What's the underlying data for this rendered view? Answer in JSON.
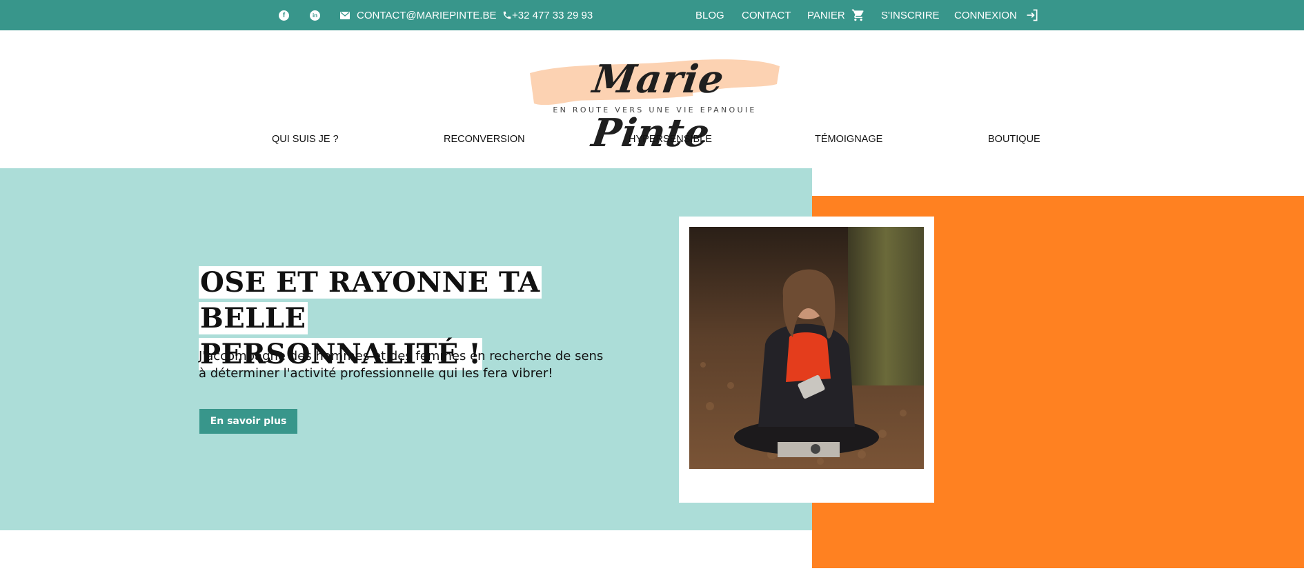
{
  "topbar": {
    "email": "CONTACT@MARIEPINTE.BE",
    "phone": "+32 477 33 29 93",
    "blog": "BLOG",
    "contact": "CONTACT",
    "cart": "PANIER",
    "register": "S'INSCRIRE",
    "login": "CONNEXION",
    "icons": [
      "facebook-icon",
      "linkedin-icon",
      "mail-icon",
      "phone-icon",
      "cart-icon",
      "login-icon"
    ]
  },
  "logo": {
    "name": "Marie Pinte",
    "tagline": "EN ROUTE VERS UNE VIE EPANOUIE"
  },
  "nav": {
    "items": [
      {
        "label": "QUI SUIS JE ?"
      },
      {
        "label": "RECONVERSION"
      },
      {
        "label": "HYPERSENSIBLE"
      },
      {
        "label": "TÉMOIGNAGE"
      },
      {
        "label": "BOUTIQUE"
      }
    ]
  },
  "hero": {
    "title_line1": "OSE ET RAYONNE TA BELLE",
    "title_line2": "PERSONNALITÉ !",
    "subtitle": "J'accompagne des hommes et des femmes en recherche de sens à déterminer l'activité professionnelle qui les fera vibrer!",
    "cta_label": "En savoir plus"
  },
  "colors": {
    "brand_teal": "#38968b",
    "hero_bg": "#acddd8",
    "accent_orange": "#ff8121",
    "logo_brush": "#fcd2b2"
  }
}
